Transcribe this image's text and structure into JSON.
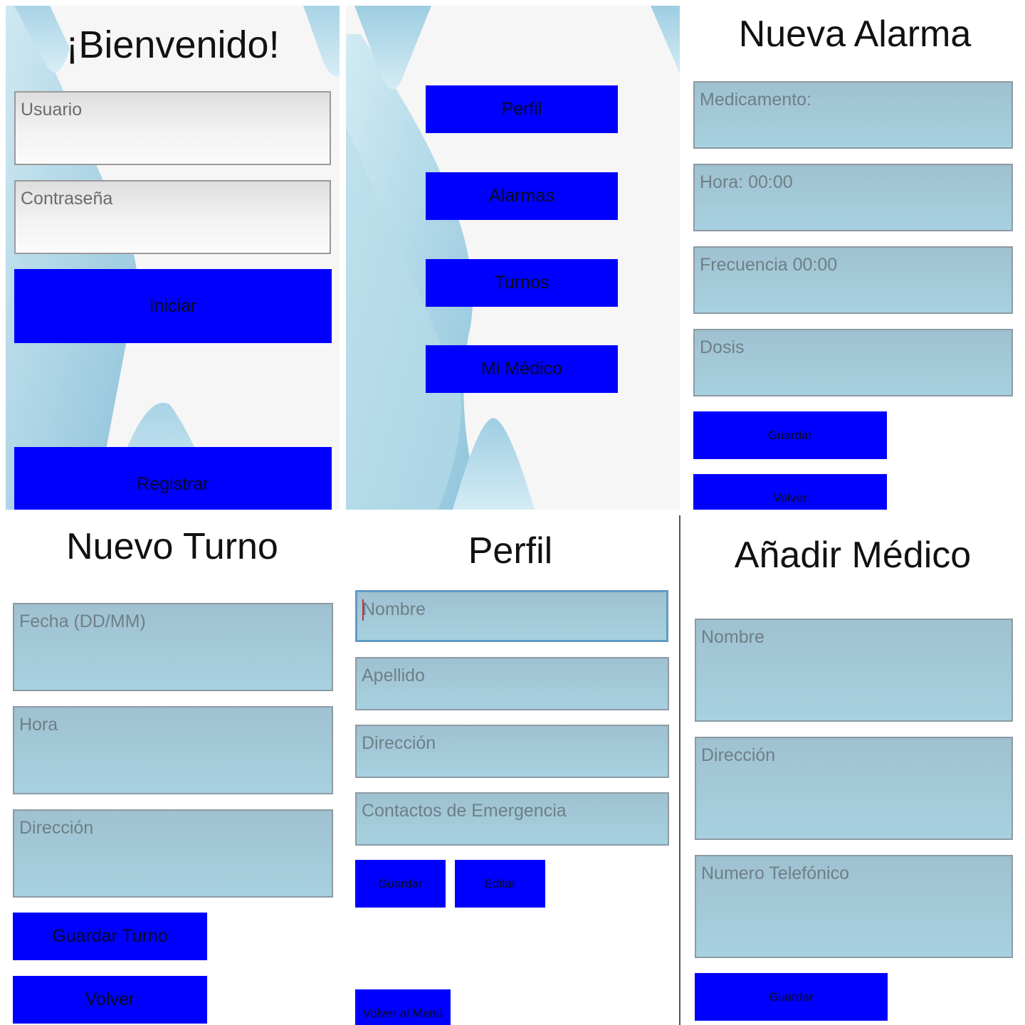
{
  "login": {
    "title": "¡Bienvenido!",
    "user_placeholder": "Usuario",
    "password_placeholder": "Contraseña",
    "start_button": "Iniciar",
    "register_button": "Registrar"
  },
  "menu": {
    "items": [
      {
        "label": "Perfil"
      },
      {
        "label": "Alarmas"
      },
      {
        "label": "Turnos"
      },
      {
        "label": "Mi Médico"
      }
    ]
  },
  "alarm": {
    "title": "Nueva Alarma",
    "medication_placeholder": "Medicamento:",
    "time_placeholder": "Hora: 00:00",
    "frequency_placeholder": "Frecuencia 00:00",
    "dose_placeholder": "Dosis",
    "save_button": "Guardar",
    "back_button": "Volver"
  },
  "appointment": {
    "title": "Nuevo Turno",
    "date_placeholder": "Fecha (DD/MM)",
    "time_placeholder": "Hora",
    "address_placeholder": "Dirección",
    "save_button": "Guardar Turno",
    "back_button": "Volver"
  },
  "profile": {
    "title": "Perfil",
    "name_placeholder": "Nombre",
    "surname_placeholder": "Apellido",
    "address_placeholder": "Dirección",
    "emergency_placeholder": "Contactos de Emergencia",
    "save_button": "Guardar",
    "edit_button": "Editar",
    "back_menu_button": "Volver al Menú"
  },
  "doctor": {
    "title": "Añadir Médico",
    "name_placeholder": "Nombre",
    "address_placeholder": "Dirección",
    "phone_placeholder": "Numero Telefónico",
    "save_button": "Guardar"
  },
  "colors": {
    "button_blue": "#0000ff",
    "background_light": "#f6f6f6",
    "field_blue": "#a7d1e0",
    "decor_light_blue": "#bfe1ee"
  }
}
